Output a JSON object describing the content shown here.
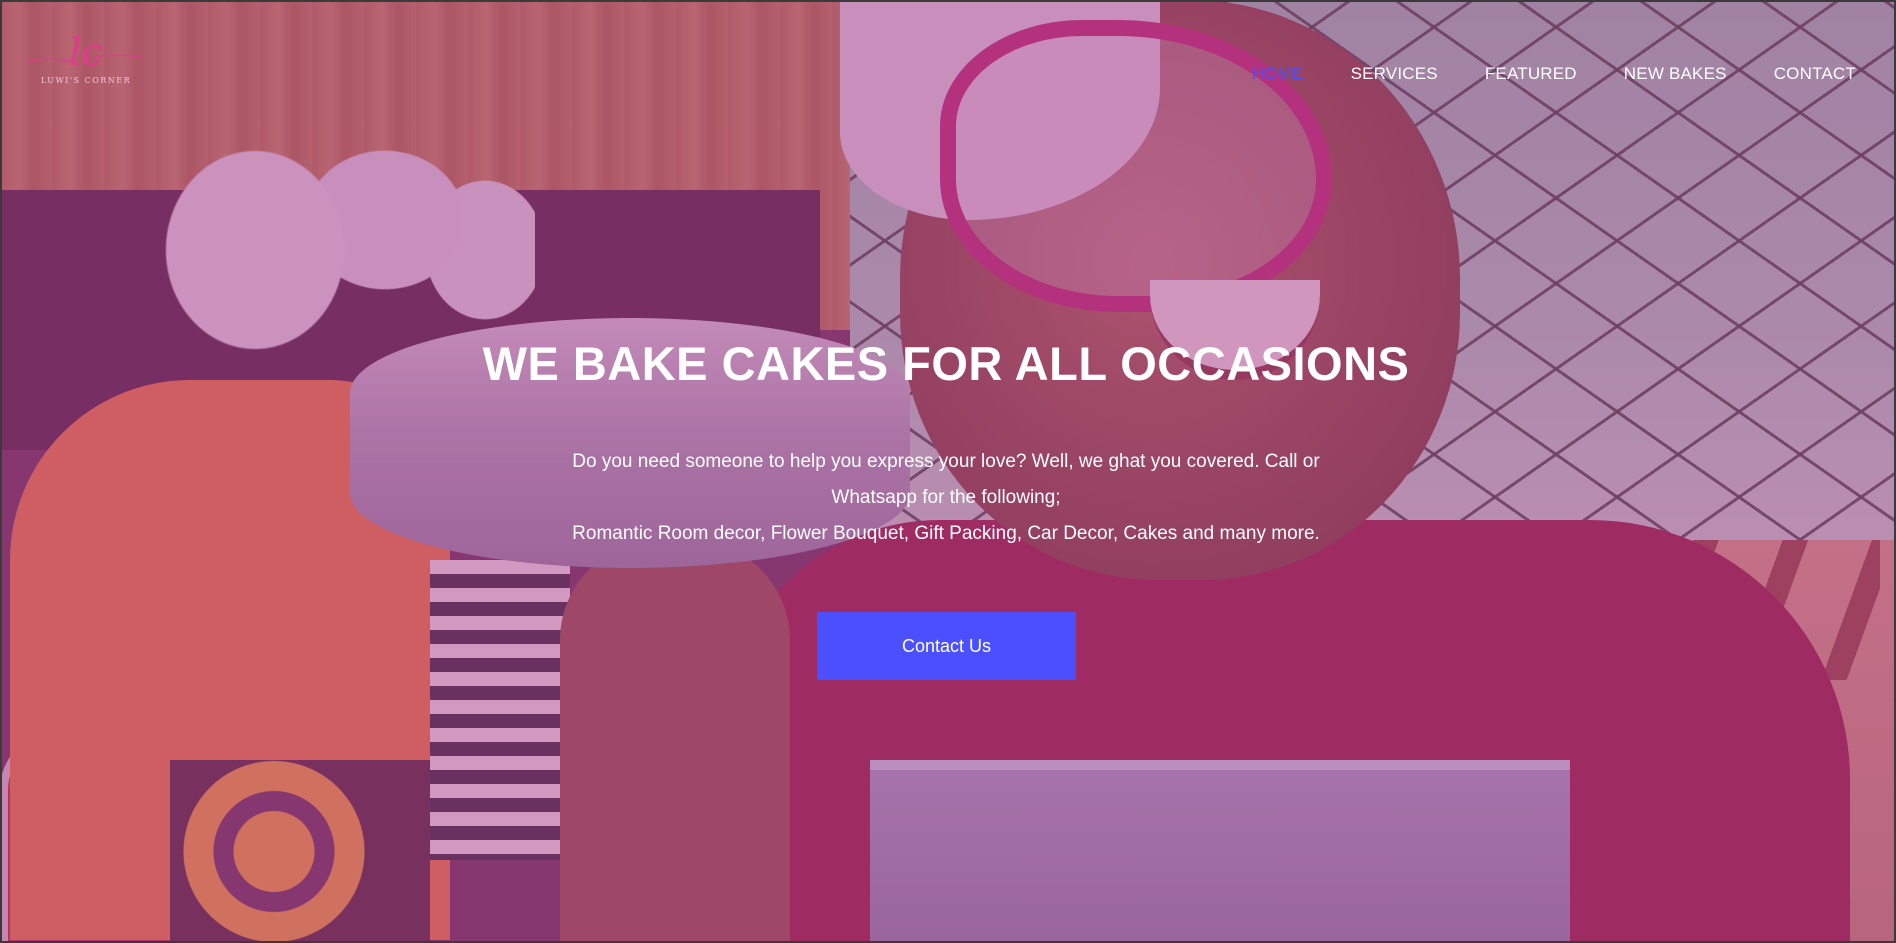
{
  "brand": {
    "logo_monogram": "lc",
    "logo_name": "LUWI'S CORNER",
    "accent_color": "#e03a8c"
  },
  "nav": {
    "items": [
      {
        "label": "HOME",
        "active": true
      },
      {
        "label": "SERVICES",
        "active": false
      },
      {
        "label": "FEATURED",
        "active": false
      },
      {
        "label": "NEW BAKES",
        "active": false
      },
      {
        "label": "CONTACT",
        "active": false
      }
    ],
    "active_color": "#4a50ff"
  },
  "hero": {
    "title": "WE BAKE CAKES FOR ALL OCCASIONS",
    "text_line1": "Do you need someone to help you express your love? Well, we ghat you covered. Call or",
    "text_line2": "Whatsapp for the following;",
    "text_line3": "Romantic Room decor, Flower Bouquet, Gift Packing, Car Decor, Cakes and many more.",
    "cta_label": "Contact Us",
    "cta_color": "#4b4ffe",
    "overlay_color": "#cd5aaf"
  }
}
